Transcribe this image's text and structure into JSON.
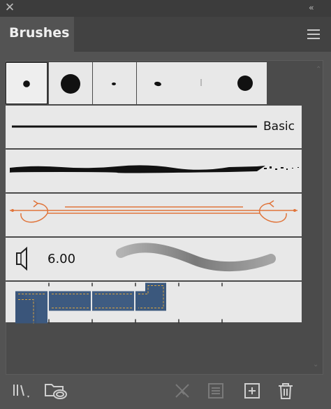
{
  "window": {
    "close_glyph": "✕",
    "collapse_glyph": "‹‹"
  },
  "panel": {
    "tab_label": "Brushes"
  },
  "rows": {
    "basic_label": "Basic",
    "pattern_size": "6.00"
  },
  "icons": {
    "libraries": "brush-libraries-icon",
    "cc_libraries": "cc-libraries-icon",
    "remove_stroke": "remove-brush-stroke-icon",
    "options": "brush-options-icon",
    "new": "new-brush-icon",
    "delete": "delete-brush-icon"
  },
  "colors": {
    "accent_orange": "#e0743a",
    "denim": "#3d5a80"
  }
}
